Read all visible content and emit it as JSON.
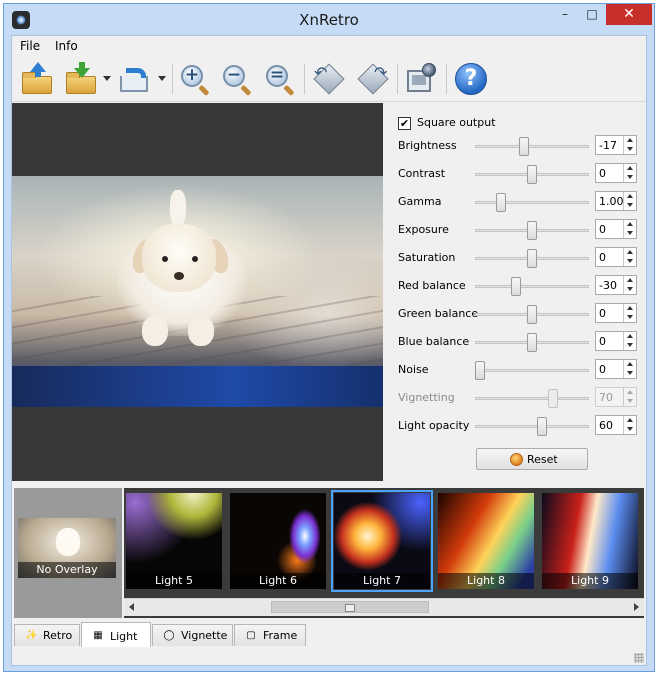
{
  "window": {
    "title": "XnRetro",
    "minimize_glyph": "–",
    "maximize_glyph": "□",
    "close_glyph": "✕"
  },
  "menu": {
    "items": [
      {
        "label": "File"
      },
      {
        "label": "Info"
      }
    ]
  },
  "toolbar": {
    "icons": [
      "open-folder-icon",
      "save-folder-icon",
      "share-export-icon",
      "zoom-in-icon",
      "zoom-out-icon",
      "zoom-fit-icon",
      "rotate-left-icon",
      "rotate-right-icon",
      "preview-settings-icon",
      "help-icon"
    ],
    "zoom_in_glyph": "+",
    "zoom_out_glyph": "−",
    "zoom_fit_glyph": "=",
    "rotate_left_glyph": "↶",
    "rotate_right_glyph": "↷",
    "help_glyph": "?"
  },
  "controls": {
    "square_output": {
      "label": "Square output",
      "checked": true,
      "check_glyph": "✔"
    },
    "params": [
      {
        "label": "Brightness",
        "value": "-17",
        "level": 0.42,
        "enabled": true
      },
      {
        "label": "Contrast",
        "value": "0",
        "level": 0.5,
        "enabled": true
      },
      {
        "label": "Gamma",
        "value": "1.00",
        "level": 0.2,
        "enabled": true
      },
      {
        "label": "Exposure",
        "value": "0",
        "level": 0.5,
        "enabled": true
      },
      {
        "label": "Saturation",
        "value": "0",
        "level": 0.5,
        "enabled": true
      },
      {
        "label": "Red balance",
        "value": "-30",
        "level": 0.35,
        "enabled": true
      },
      {
        "label": "Green balance",
        "value": "0",
        "level": 0.5,
        "enabled": true
      },
      {
        "label": "Blue balance",
        "value": "0",
        "level": 0.5,
        "enabled": true
      },
      {
        "label": "Noise",
        "value": "0",
        "level": 0.0,
        "enabled": true
      },
      {
        "label": "Vignetting",
        "value": "70",
        "level": 0.7,
        "enabled": false
      },
      {
        "label": "Light opacity",
        "value": "60",
        "level": 0.6,
        "enabled": true
      }
    ],
    "reset_label": "Reset"
  },
  "overlays": {
    "none_label": "No Overlay",
    "items": [
      {
        "label": "Light 5",
        "selected": false
      },
      {
        "label": "Light 6",
        "selected": false
      },
      {
        "label": "Light 7",
        "selected": true
      },
      {
        "label": "Light 8",
        "selected": false
      },
      {
        "label": "Light 9",
        "selected": false
      }
    ]
  },
  "tabs": [
    {
      "label": "Retro",
      "icon": "magic-wand-icon",
      "glyph": "✨",
      "active": false
    },
    {
      "label": "Light",
      "icon": "light-grid-icon",
      "glyph": "▦",
      "active": true
    },
    {
      "label": "Vignette",
      "icon": "vignette-icon",
      "glyph": "◯",
      "active": false
    },
    {
      "label": "Frame",
      "icon": "frame-icon",
      "glyph": "▢",
      "active": false
    }
  ]
}
